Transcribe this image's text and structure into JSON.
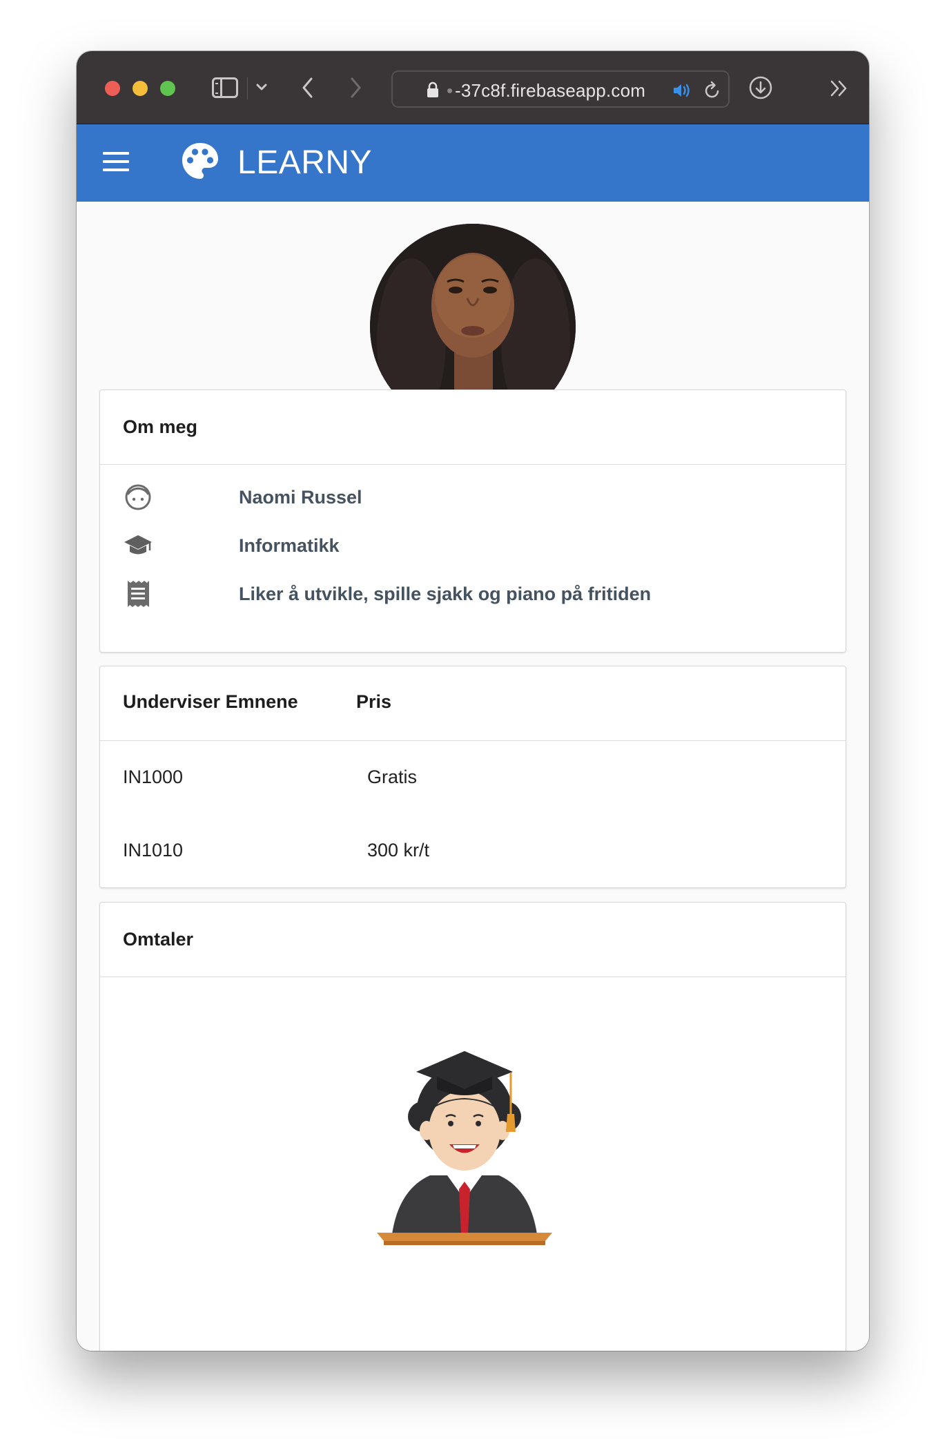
{
  "browser": {
    "url_fade": "•",
    "url": "-37c8f.firebaseapp.com"
  },
  "app": {
    "brand_bold": "LE",
    "brand_light": "ARNY"
  },
  "about": {
    "title": "Om meg",
    "name": "Naomi Russel",
    "study": "Informatikk",
    "bio": "Liker å utvikle, spille sjakk og piano på fritiden"
  },
  "courses": {
    "header_subjects": "Underviser Emnene",
    "header_price": "Pris",
    "rows": [
      {
        "code": "IN1000",
        "price": "Gratis"
      },
      {
        "code": "IN1010",
        "price": "300 kr/t"
      }
    ]
  },
  "reviews": {
    "title": "Omtaler"
  },
  "colors": {
    "appbar": "#3576cb",
    "toolbar": "#3a3638",
    "label_text": "#455260"
  }
}
